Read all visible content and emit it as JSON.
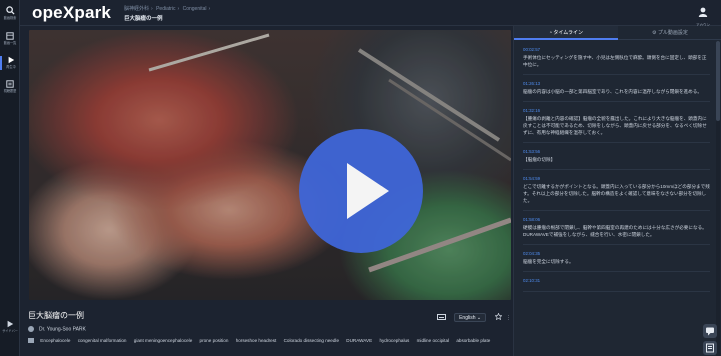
{
  "app": {
    "logo": "opeXpark"
  },
  "rail": [
    {
      "icon": "search-icon",
      "label": "動画検索"
    },
    {
      "icon": "video-library-icon",
      "label": "動画一覧"
    },
    {
      "icon": "play-icon",
      "label": "再生中"
    },
    {
      "icon": "list-icon",
      "label": "視聴履歴"
    },
    {
      "icon": "expand-icon",
      "label": "サイドバー"
    }
  ],
  "header": {
    "breadcrumbs": [
      "脳神経外科",
      "Pediatric",
      "Congenital"
    ],
    "page_title": "巨大脳瘤の一例",
    "account_label": "アカウント"
  },
  "video": {
    "title": "巨大脳瘤の一例",
    "author": "Dr. Young-Soo PARK",
    "tags": [
      "Encephalocele",
      "congenital malformation",
      "giant meningoencephalocele",
      "prone position",
      "horseshoe headrest",
      "Colorado dissecting needle",
      "DURAWAVE",
      "hydrocephalus",
      "midline occipital",
      "absorbable plate"
    ],
    "language": "English"
  },
  "panel": {
    "tabs": [
      "タイムライン",
      "プル動画設定"
    ],
    "timeline": [
      {
        "time": "00:02:57",
        "text": "手術体位にセッティングを施す中、小児は左側臥位で麻酔。頭側を台に固定し、頭部を正中位に。"
      },
      {
        "time": "01:26:13",
        "text": "脳瘤の内容は小脳の一部と第四脳室であり、これを内容に温存しながら閉鎖を進める。"
      },
      {
        "time": "01:32:16",
        "text": "【腫瘍の剥離と内容の確認】脳瘤の全貌を露出した。これにより大きな脳瘤を、頭蓋内に戻すことは不可能であるため、切除をしながら、頭蓋内に戻せる部分を、なるべく切除せずに、有用な神経組織を温存しておく。"
      },
      {
        "time": "01:53:56",
        "text": "【脳瘤の切除】"
      },
      {
        "time": "01:54:59",
        "text": "どこで切離するかがポイントとなる。頭蓋内に入っている部分から10mmほどの部分まで残す。それ以上の部分を切除した。脳幹の構造をよく確認して意味をなさない部分を切除した。"
      },
      {
        "time": "01:58:06",
        "text": "硬膜は腫瘤の根部で閉鎖し、脳幹や第四脳室の再建のためには十分な広さが必要になる。DURAWAVEで補強をしながら、縫合を行い、水密に閉鎖した。"
      },
      {
        "time": "02:04:35",
        "text": "脳瘤を完全に切除する。"
      },
      {
        "time": "02:10:31",
        "text": ""
      }
    ]
  }
}
